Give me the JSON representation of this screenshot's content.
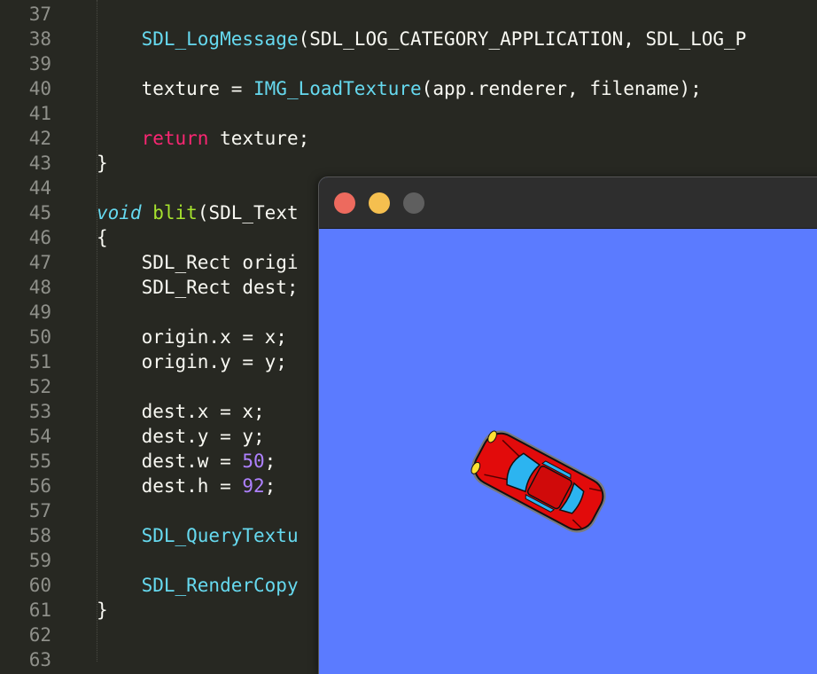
{
  "editor": {
    "lines": [
      {
        "num": "37",
        "tokens": []
      },
      {
        "num": "38",
        "tokens": [
          {
            "t": "    ",
            "c": "plain"
          },
          {
            "t": "SDL_LogMessage",
            "c": "fn"
          },
          {
            "t": "(SDL_LOG_CATEGORY_APPLICATION, SDL_LOG_P",
            "c": "plain"
          }
        ]
      },
      {
        "num": "39",
        "tokens": []
      },
      {
        "num": "40",
        "tokens": [
          {
            "t": "    texture = ",
            "c": "plain"
          },
          {
            "t": "IMG_LoadTexture",
            "c": "fn"
          },
          {
            "t": "(app.renderer, filename);",
            "c": "plain"
          }
        ]
      },
      {
        "num": "41",
        "tokens": []
      },
      {
        "num": "42",
        "tokens": [
          {
            "t": "    ",
            "c": "plain"
          },
          {
            "t": "return",
            "c": "kw"
          },
          {
            "t": " texture;",
            "c": "plain"
          }
        ]
      },
      {
        "num": "43",
        "tokens": [
          {
            "t": "}",
            "c": "plain"
          }
        ]
      },
      {
        "num": "44",
        "tokens": []
      },
      {
        "num": "45",
        "tokens": [
          {
            "t": "void",
            "c": "type"
          },
          {
            "t": " ",
            "c": "plain"
          },
          {
            "t": "blit",
            "c": "def"
          },
          {
            "t": "(SDL_Text",
            "c": "plain"
          }
        ]
      },
      {
        "num": "46",
        "tokens": [
          {
            "t": "{",
            "c": "plain"
          }
        ]
      },
      {
        "num": "47",
        "tokens": [
          {
            "t": "    SDL_Rect origi",
            "c": "plain"
          }
        ]
      },
      {
        "num": "48",
        "tokens": [
          {
            "t": "    SDL_Rect dest;",
            "c": "plain"
          }
        ]
      },
      {
        "num": "49",
        "tokens": []
      },
      {
        "num": "50",
        "tokens": [
          {
            "t": "    origin.x = x;",
            "c": "plain"
          }
        ]
      },
      {
        "num": "51",
        "tokens": [
          {
            "t": "    origin.y = y;",
            "c": "plain"
          }
        ]
      },
      {
        "num": "52",
        "tokens": []
      },
      {
        "num": "53",
        "tokens": [
          {
            "t": "    dest.x = x;",
            "c": "plain"
          }
        ]
      },
      {
        "num": "54",
        "tokens": [
          {
            "t": "    dest.y = y;",
            "c": "plain"
          }
        ]
      },
      {
        "num": "55",
        "tokens": [
          {
            "t": "    dest.w = ",
            "c": "plain"
          },
          {
            "t": "50",
            "c": "num"
          },
          {
            "t": ";",
            "c": "plain"
          }
        ]
      },
      {
        "num": "56",
        "tokens": [
          {
            "t": "    dest.h = ",
            "c": "plain"
          },
          {
            "t": "92",
            "c": "num"
          },
          {
            "t": ";",
            "c": "plain"
          }
        ]
      },
      {
        "num": "57",
        "tokens": []
      },
      {
        "num": "58",
        "tokens": [
          {
            "t": "    ",
            "c": "plain"
          },
          {
            "t": "SDL_QueryTextu",
            "c": "fn"
          }
        ]
      },
      {
        "num": "59",
        "tokens": []
      },
      {
        "num": "60",
        "tokens": [
          {
            "t": "    ",
            "c": "plain"
          },
          {
            "t": "SDL_RenderCopy",
            "c": "fn"
          }
        ]
      },
      {
        "num": "61",
        "tokens": [
          {
            "t": "}",
            "c": "plain"
          }
        ]
      },
      {
        "num": "62",
        "tokens": []
      },
      {
        "num": "63",
        "tokens": []
      }
    ]
  },
  "window": {
    "buttons": [
      {
        "name": "close-button",
        "color": "#ed6a5e"
      },
      {
        "name": "minimize-button",
        "color": "#f5bf4f"
      },
      {
        "name": "zoom-button",
        "color": "#5f5f5f"
      }
    ],
    "canvas_color": "#5b7bff"
  },
  "colors": {
    "editor_bg": "#272822",
    "function": "#66d9ef",
    "keyword": "#f92672",
    "number": "#ae81ff",
    "definition": "#a6e22e",
    "car_body": "#e20b0b",
    "car_glass": "#2cb4f0"
  }
}
